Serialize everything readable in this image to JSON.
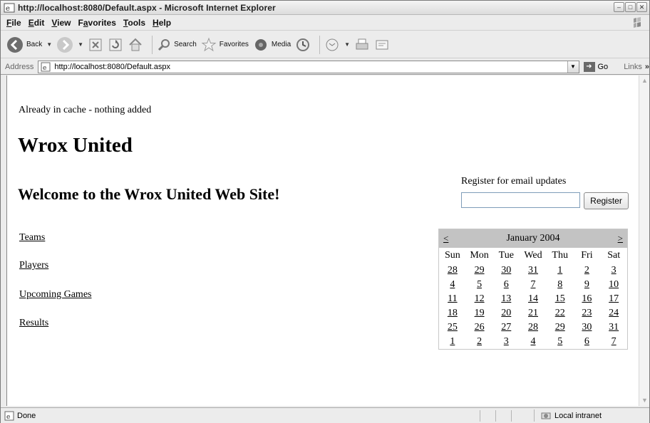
{
  "window": {
    "title": "http://localhost:8080/Default.aspx - Microsoft Internet Explorer"
  },
  "menu": [
    {
      "label_ul": "F",
      "label_rest": "ile"
    },
    {
      "label_ul": "E",
      "label_rest": "dit"
    },
    {
      "label_ul": "V",
      "label_rest": "iew"
    },
    {
      "label_pre": "F",
      "label_ul": "a",
      "label_rest": "vorites"
    },
    {
      "label_ul": "T",
      "label_rest": "ools"
    },
    {
      "label_ul": "H",
      "label_rest": "elp"
    }
  ],
  "toolbar": {
    "back": "Back",
    "search": "Search",
    "favorites": "Favorites",
    "media": "Media"
  },
  "address": {
    "label": "Address",
    "url": "http://localhost:8080/Default.aspx",
    "go": "Go",
    "links": "Links",
    "chevron": "»"
  },
  "page": {
    "cache_message": "Already in cache - nothing added",
    "site_title": "Wrox United",
    "welcome": "Welcome to the Wrox United Web Site!",
    "nav": [
      "Teams",
      "Players",
      "Upcoming Games",
      "Results"
    ],
    "register_label": "Register for email updates",
    "register_value": "",
    "register_button": "Register"
  },
  "calendar": {
    "month": "January 2004",
    "prev": "<",
    "next": ">",
    "days_of_week": [
      "Sun",
      "Mon",
      "Tue",
      "Wed",
      "Thu",
      "Fri",
      "Sat"
    ],
    "weeks": [
      [
        "28",
        "29",
        "30",
        "31",
        "1",
        "2",
        "3"
      ],
      [
        "4",
        "5",
        "6",
        "7",
        "8",
        "9",
        "10"
      ],
      [
        "11",
        "12",
        "13",
        "14",
        "15",
        "16",
        "17"
      ],
      [
        "18",
        "19",
        "20",
        "21",
        "22",
        "23",
        "24"
      ],
      [
        "25",
        "26",
        "27",
        "28",
        "29",
        "30",
        "31"
      ],
      [
        "1",
        "2",
        "3",
        "4",
        "5",
        "6",
        "7"
      ]
    ]
  },
  "status": {
    "text": "Done",
    "zone": "Local intranet"
  }
}
